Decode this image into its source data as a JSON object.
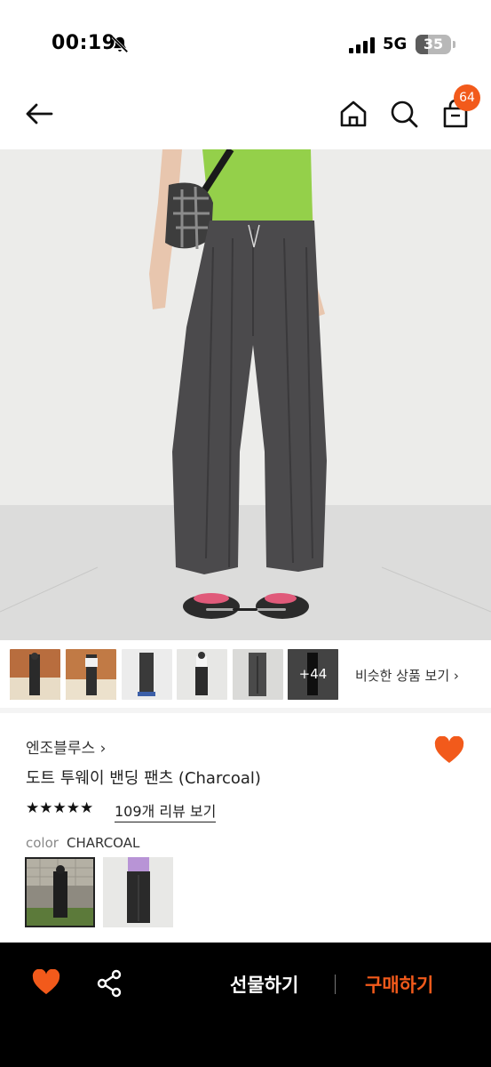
{
  "status_bar": {
    "time": "00:19",
    "network": "5G",
    "battery": "35",
    "battery_level": 0.35,
    "icons": [
      "bell-off-icon",
      "signal-icon",
      "battery-icon"
    ]
  },
  "nav": {
    "icons": [
      "back-arrow-icon",
      "home-icon",
      "search-icon",
      "shopping-bag-icon"
    ],
    "cart_count": "64"
  },
  "gallery": {
    "current_image": 1,
    "more_count": "+44",
    "similar_label": "비슷한 상품 보기 ›"
  },
  "product": {
    "brand": "엔조블루스 ›",
    "title": "도트 투웨이 밴딩 팬츠 (Charcoal)",
    "stars": "★★★★★",
    "rating": 5,
    "reviews_label": "109개 리뷰 보기",
    "color_label": "color",
    "color_value": "CHARCOAL",
    "favorited": true
  },
  "bottom_bar": {
    "gift_label": "선물하기",
    "buy_label": "구매하기",
    "icons": [
      "heart-icon",
      "share-icon"
    ]
  },
  "colors": {
    "accent": "#f25a1b",
    "bottom_bar_bg": "#000000",
    "text": "#222222"
  }
}
